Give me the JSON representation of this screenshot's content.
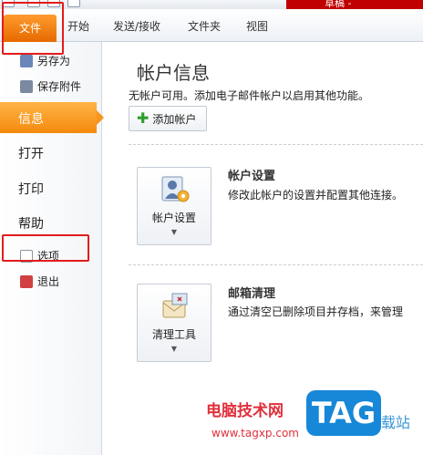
{
  "titlebar": {
    "title_fragment": "草稿 -"
  },
  "ribbon": {
    "tabs": [
      {
        "label": "文件"
      },
      {
        "label": "开始"
      },
      {
        "label": "发送/接收"
      },
      {
        "label": "文件夹"
      },
      {
        "label": "视图"
      }
    ]
  },
  "nav": {
    "save_as": "另存为",
    "save_attachments": "保存附件",
    "info": "信息",
    "open": "打开",
    "print": "打印",
    "help": "帮助",
    "options": "选项",
    "exit": "退出"
  },
  "main": {
    "title": "帐户信息",
    "description": "无帐户可用。添加电子邮件帐户以启用其他功能。",
    "add_account": "添加帐户",
    "account_settings": {
      "button_label": "帐户设置",
      "title": "帐户设置",
      "description": "修改此帐户的设置并配置其他连接。"
    },
    "cleanup": {
      "button_label": "清理工具",
      "title": "邮箱清理",
      "description": "通过清空已删除项目并存档，来管理"
    }
  },
  "watermark": {
    "site_name": "电脑技术网",
    "site_url": "www.tagxp.com",
    "logo_text": "TAG",
    "suffix": "载站"
  },
  "colors": {
    "accent_orange": "#f58a0c",
    "highlight_red": "#e21c1c",
    "title_red": "#c00000"
  }
}
